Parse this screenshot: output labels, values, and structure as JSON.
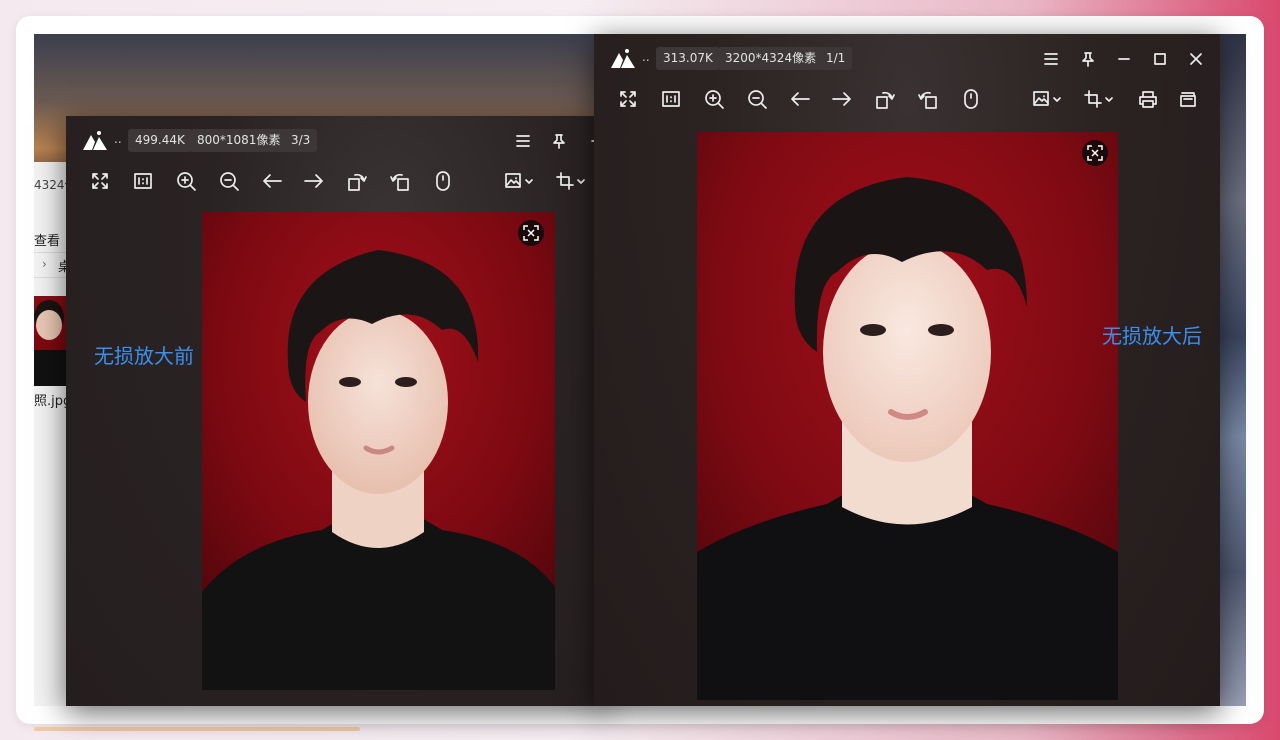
{
  "explorer": {
    "path_text": "4324像",
    "view_label": "查看",
    "tree_label": "桌",
    "file_name": "照.jpg"
  },
  "left_viewer": {
    "file_size": "499.44K",
    "dimensions": "800*1081像素",
    "index": "3/3",
    "caption": "无损放大前"
  },
  "right_viewer": {
    "file_size": "313.07K",
    "dimensions": "3200*4324像素",
    "index": "1/1",
    "caption": "无损放大后"
  },
  "common": {
    "dots": "..",
    "accent_color": "#3a8ff0",
    "photo_background": "#8a0d14"
  },
  "toolbar_icons": [
    "fullscreen-icon",
    "actual-size-icon",
    "zoom-in-icon",
    "zoom-out-icon",
    "previous-icon",
    "next-icon",
    "rotate-left-icon",
    "rotate-right-icon",
    "mouse-icon",
    "image-adjust-icon",
    "crop-icon",
    "print-icon",
    "open-folder-icon"
  ],
  "window_icons": [
    "menu-icon",
    "pin-icon",
    "minimize-icon",
    "maximize-icon",
    "close-icon"
  ]
}
